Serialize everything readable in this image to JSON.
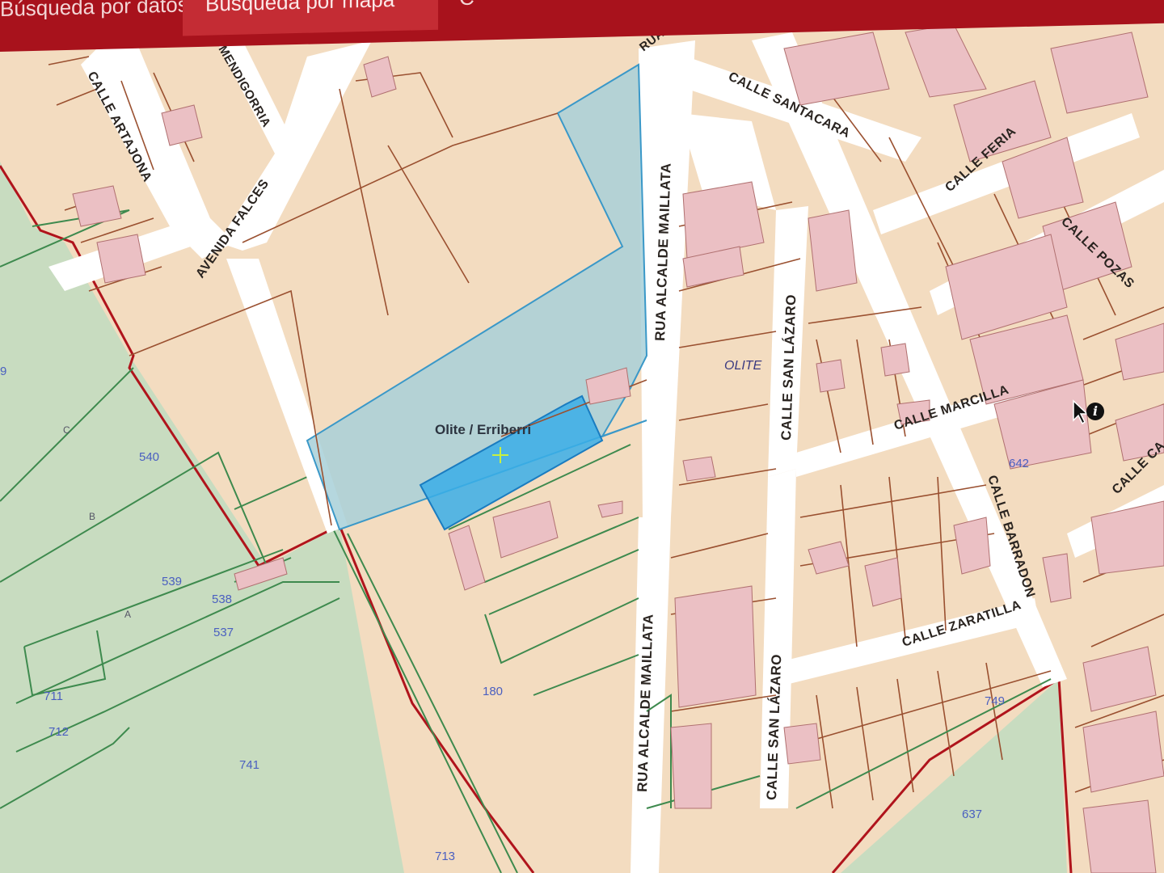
{
  "tabs": [
    {
      "label": "Búsqueda por datos"
    },
    {
      "label": "Búsqueda por mapa"
    },
    {
      "label": "C"
    }
  ],
  "colors": {
    "header_bar": "#a8121c",
    "active_tab": "#c42c34",
    "urban_fill": "#f3dcc0",
    "rustic_fill": "#c8dcc0",
    "building_fill": "#ebc0c4",
    "selected_parcel": "#a8d0d8",
    "highlight_parcel": "#3aaee8",
    "municipal_boundary": "#b0141c"
  },
  "map": {
    "selected_parcel_label": "Olite / Erriberri",
    "town_label": "OLITE",
    "streets": {
      "calle_artajona": "CALLE ARTAJONA",
      "mendigorria": "MENDIGORRIA",
      "avenida_falces": "AVENIDA FALCES",
      "rua_top": "RUA A",
      "calle_santacara": "CALLE SANTACARA",
      "calle_feria": "CALLE FERIA",
      "calle_pozas": "CALLE POZAS",
      "rua_alcalde_maillata_north": "RUA ALCALDE MAILLATA",
      "calle_san_lazaro_north": "CALLE SAN LÁZARO",
      "calle_marcilla": "CALLE MARCILLA",
      "calle_barradon": "CALLE BARRADON",
      "calle_zaratilla": "CALLE ZARATILLA",
      "rua_alcalde_maillata_south": "RUA ALCALDE MAILLATA",
      "calle_san_lazaro_south": "CALLE SAN LÁZARO",
      "calle_ca": "CALLE CA"
    },
    "parcels": [
      "540",
      "539",
      "538",
      "537",
      "711",
      "712",
      "741",
      "713",
      "180",
      "642",
      "749",
      "637",
      "9"
    ],
    "sub_letters": [
      "C",
      "B",
      "A"
    ]
  }
}
